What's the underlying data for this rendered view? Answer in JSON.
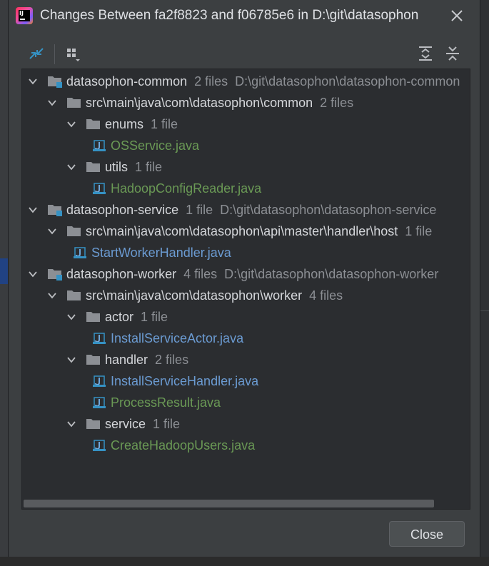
{
  "dialog": {
    "title": "Changes Between fa2f8823 and f06785e6 in D:\\git\\datasophon",
    "close_label": "Close"
  },
  "toolbar": {
    "icons": [
      "compare-arrows-icon",
      "group-by-icon",
      "expand-all-icon",
      "collapse-all-icon"
    ]
  },
  "tree": {
    "rows": [
      {
        "level": 0,
        "kind": "module",
        "name": "datasophon-common",
        "meta": "2 files  D:\\git\\datasophon\\datasophon-common"
      },
      {
        "level": 1,
        "kind": "folder",
        "name": "src\\main\\java\\com\\datasophon\\common",
        "meta": "2 files"
      },
      {
        "level": 2,
        "kind": "folder",
        "name": "enums",
        "meta": "1 file"
      },
      {
        "level": 3,
        "kind": "file",
        "name": "OSService.java",
        "status": "added"
      },
      {
        "level": 2,
        "kind": "folder",
        "name": "utils",
        "meta": "1 file"
      },
      {
        "level": 3,
        "kind": "file",
        "name": "HadoopConfigReader.java",
        "status": "added"
      },
      {
        "level": 0,
        "kind": "module",
        "name": "datasophon-service",
        "meta": "1 file  D:\\git\\datasophon\\datasophon-service"
      },
      {
        "level": 1,
        "kind": "folder",
        "name": "src\\main\\java\\com\\datasophon\\api\\master\\handler\\host",
        "meta": "1 file"
      },
      {
        "level": 2,
        "kind": "file",
        "name": "StartWorkerHandler.java",
        "status": "modified"
      },
      {
        "level": 0,
        "kind": "module",
        "name": "datasophon-worker",
        "meta": "4 files  D:\\git\\datasophon\\datasophon-worker"
      },
      {
        "level": 1,
        "kind": "folder",
        "name": "src\\main\\java\\com\\datasophon\\worker",
        "meta": "4 files"
      },
      {
        "level": 2,
        "kind": "folder",
        "name": "actor",
        "meta": "1 file"
      },
      {
        "level": 3,
        "kind": "file",
        "name": "InstallServiceActor.java",
        "status": "modified"
      },
      {
        "level": 2,
        "kind": "folder",
        "name": "handler",
        "meta": "2 files"
      },
      {
        "level": 3,
        "kind": "file",
        "name": "InstallServiceHandler.java",
        "status": "modified"
      },
      {
        "level": 3,
        "kind": "file",
        "name": "ProcessResult.java",
        "status": "added"
      },
      {
        "level": 2,
        "kind": "folder",
        "name": "service",
        "meta": "1 file"
      },
      {
        "level": 3,
        "kind": "file",
        "name": "CreateHadoopUsers.java",
        "status": "added"
      }
    ]
  },
  "colors": {
    "added": "#6a9955",
    "modified": "#6b9bd2",
    "accent": "#3592c4"
  }
}
